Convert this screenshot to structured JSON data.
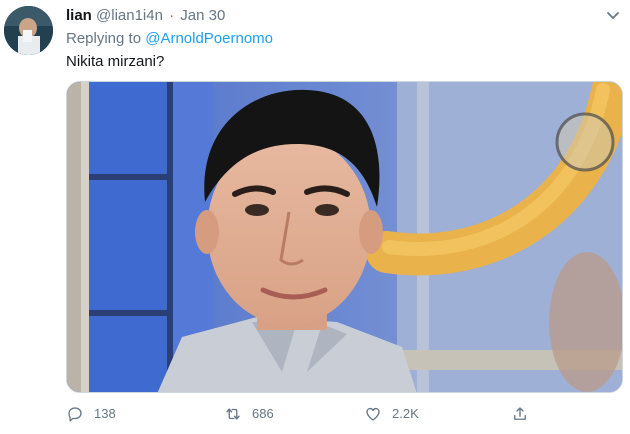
{
  "tweet": {
    "display_name": "lian",
    "handle": "@lian1i4n",
    "separator": "·",
    "date": "Jan 30",
    "replying_prefix": "Replying to",
    "replying_to": "@ArnoldPoernomo",
    "text": "Nikita mirzani?",
    "colors": {
      "link": "#1da1f2",
      "secondary": "#657786",
      "primary": "#14171a"
    }
  },
  "actions": {
    "reply": {
      "icon": "reply-icon",
      "count": "138"
    },
    "retweet": {
      "icon": "retweet-icon",
      "count": "686"
    },
    "like": {
      "icon": "heart-icon",
      "count": "2.2K"
    },
    "share": {
      "icon": "share-icon"
    }
  }
}
